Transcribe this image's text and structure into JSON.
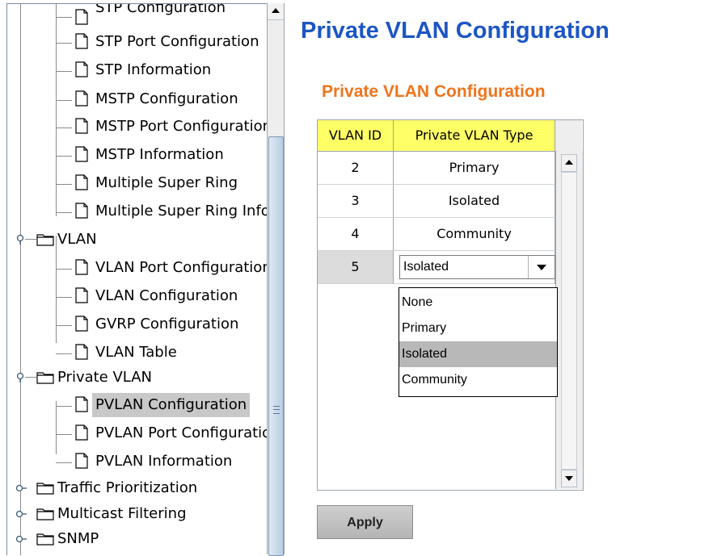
{
  "tree": {
    "items": [
      {
        "label": "STP Configuration",
        "kind": "file"
      },
      {
        "label": "STP Port Configuration",
        "kind": "file"
      },
      {
        "label": "STP Information",
        "kind": "file"
      },
      {
        "label": "MSTP Configuration",
        "kind": "file"
      },
      {
        "label": "MSTP Port Configuration",
        "kind": "file"
      },
      {
        "label": "MSTP Information",
        "kind": "file"
      },
      {
        "label": "Multiple Super Ring",
        "kind": "file"
      },
      {
        "label": "Multiple Super Ring Information",
        "kind": "file"
      },
      {
        "label": "VLAN",
        "kind": "folder",
        "expanded": true
      },
      {
        "label": "VLAN Port Configuration",
        "kind": "file"
      },
      {
        "label": "VLAN Configuration",
        "kind": "file"
      },
      {
        "label": "GVRP Configuration",
        "kind": "file"
      },
      {
        "label": "VLAN Table",
        "kind": "file"
      },
      {
        "label": "Private VLAN",
        "kind": "folder",
        "expanded": true
      },
      {
        "label": "PVLAN Configuration",
        "kind": "file",
        "selected": true
      },
      {
        "label": "PVLAN Port Configuration",
        "kind": "file"
      },
      {
        "label": "PVLAN Information",
        "kind": "file"
      },
      {
        "label": "Traffic Prioritization",
        "kind": "folder",
        "expanded": false
      },
      {
        "label": "Multicast Filtering",
        "kind": "folder",
        "expanded": false
      },
      {
        "label": "SNMP",
        "kind": "folder",
        "expanded": false
      }
    ]
  },
  "page_title": "Private VLAN Configuration",
  "section_title": "Private VLAN Configuration",
  "table": {
    "headers": [
      "VLAN ID",
      "Private VLAN Type"
    ],
    "rows": [
      {
        "id": "2",
        "type": "Primary"
      },
      {
        "id": "3",
        "type": "Isolated"
      },
      {
        "id": "4",
        "type": "Community"
      },
      {
        "id": "5",
        "type": "Isolated"
      }
    ]
  },
  "combo": {
    "value": "Isolated",
    "options": [
      "None",
      "Primary",
      "Isolated",
      "Community"
    ],
    "selected_option": "Isolated"
  },
  "apply_label": "Apply",
  "colors": {
    "title_blue": "#1c56c4",
    "section_orange": "#f0741c",
    "header_yellow": "#ffff66"
  }
}
